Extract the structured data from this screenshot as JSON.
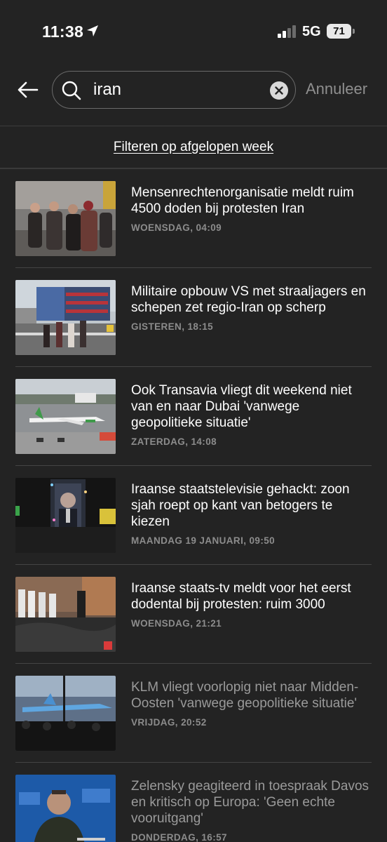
{
  "status_bar": {
    "time": "11:38",
    "network": "5G",
    "battery": "71"
  },
  "search": {
    "query": "iran",
    "cancel_label": "Annuleer"
  },
  "filter": {
    "label": "Filteren op afgelopen week"
  },
  "articles": [
    {
      "title": "Mensenrechtenorganisatie meldt ruim 4500 doden bij protesten Iran",
      "date": "WOENSDAG, 04:09",
      "read": false
    },
    {
      "title": "Militaire opbouw VS met straaljagers en schepen zet regio-Iran op scherp",
      "date": "GISTEREN, 18:15",
      "read": false
    },
    {
      "title": "Ook Transavia vliegt dit weekend niet van en naar Dubai 'vanwege geopolitieke situatie'",
      "date": "ZATERDAG, 14:08",
      "read": false
    },
    {
      "title": "Iraanse staatstelevisie gehackt: zoon sjah roept op kant van betogers te kiezen",
      "date": "MAANDAG 19 JANUARI, 09:50",
      "read": false
    },
    {
      "title": "Iraanse staats-tv meldt voor het eerst dodental bij protesten: ruim 3000",
      "date": "WOENSDAG, 21:21",
      "read": false
    },
    {
      "title": "KLM vliegt voorlopig niet naar Midden-Oosten 'vanwege geopolitieke situatie'",
      "date": "VRIJDAG, 20:52",
      "read": true
    },
    {
      "title": "Zelensky geagiteerd in toespraak Davos en kritisch op Europa: 'Geen echte vooruitgang'",
      "date": "DONDERDAG, 16:57",
      "read": true
    }
  ]
}
